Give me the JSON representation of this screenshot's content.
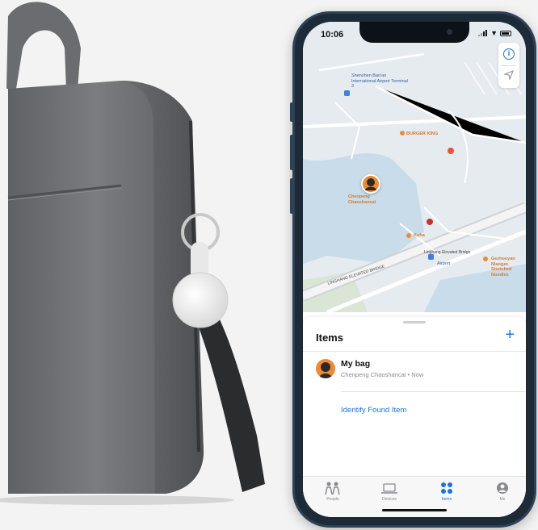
{
  "status_bar": {
    "time": "10:06"
  },
  "map": {
    "labels": {
      "airport_terminal": "Shenzhen Bao'an International Airport Terminal 3",
      "burger_king": "BURGER KING",
      "person_name": "Chenpeng Chaoshancai",
      "koha": "Koha",
      "elevated_bridge": "Linghang Elevated Bridge",
      "airport": "Airport",
      "restaurant": "Gezhouyan Niangze Stretched Noodles",
      "linghang_bridge_road": "LINGHANG ELEVATED BRIDGE"
    }
  },
  "sheet": {
    "title": "Items",
    "add_label": "+",
    "items": [
      {
        "name": "My bag",
        "subtitle": "Chenpeng Chaoshancai • Now"
      }
    ],
    "identify_label": "Identify Found Item"
  },
  "tabs": [
    {
      "label": "People",
      "icon": "people-icon"
    },
    {
      "label": "Devices",
      "icon": "laptop-icon"
    },
    {
      "label": "Items",
      "icon": "grid-icon"
    },
    {
      "label": "Me",
      "icon": "person-icon"
    }
  ],
  "colors": {
    "accent": "#1a73e8",
    "map_background": "#e6ebf0",
    "pin_orange": "#f08a32",
    "bag_gray": "#76787b"
  }
}
